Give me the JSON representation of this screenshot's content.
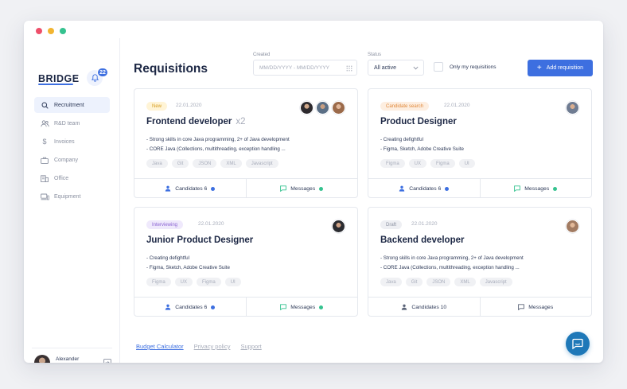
{
  "app": {
    "logo": "BRIDGE",
    "notifications_count": "22"
  },
  "sidebar": {
    "items": [
      {
        "label": "Recruitment",
        "icon": "search-icon",
        "active": true
      },
      {
        "label": "R&D team",
        "icon": "users-icon",
        "active": false
      },
      {
        "label": "Invoices",
        "icon": "dollar-icon",
        "active": false
      },
      {
        "label": "Company",
        "icon": "briefcase-icon",
        "active": false
      },
      {
        "label": "Office",
        "icon": "building-icon",
        "active": false
      },
      {
        "label": "Equipment",
        "icon": "devices-icon",
        "active": false
      }
    ],
    "user": {
      "name": "Alexander Morrison"
    }
  },
  "header": {
    "title": "Requisitions",
    "created_label": "Created",
    "date_placeholder": "MM/DD/YYYY - MM/DD/YYYY",
    "status_label": "Status",
    "status_value": "All active",
    "only_mine_label": "Only my requisitions",
    "add_button": "Add requisition"
  },
  "cards": [
    {
      "status": "New",
      "date": "22.01.2020",
      "title": "Frontend developer",
      "multiplier": "x2",
      "desc": [
        "- Strong skills in core Java programming, 2+ of Java development",
        "- CORE Java (Collections, multithreading, exception handling ..."
      ],
      "tags": [
        "Java",
        "Git",
        "JSON",
        "XML",
        "Javascript"
      ],
      "candidates_label": "Candidates",
      "candidates_count": "6",
      "messages_label": "Messages"
    },
    {
      "status": "Candidate search",
      "date": "22.01.2020",
      "title": "Product Designer",
      "desc": [
        "- Creating defightful",
        "- Figma, Sketch, Adobe Creative Suite"
      ],
      "tags": [
        "Figma",
        "UX",
        "Figma",
        "UI"
      ],
      "candidates_label": "Candidates",
      "candidates_count": "6",
      "messages_label": "Messages"
    },
    {
      "status": "Interviewing",
      "date": "22.01.2020",
      "title": "Junior Product Designer",
      "desc": [
        "- Creating defightful",
        "- Figma, Sketch, Adobe Creative Suite"
      ],
      "tags": [
        "Figma",
        "UX",
        "Figma",
        "UI"
      ],
      "candidates_label": "Candidates",
      "candidates_count": "6",
      "messages_label": "Messages"
    },
    {
      "status": "Draft",
      "date": "22.01.2020",
      "title": "Backend developer",
      "desc": [
        "- Strong skills in core Java programming, 2+ of Java development",
        "- CORE Java (Collections, multithreading, exception handling ..."
      ],
      "tags": [
        "Java",
        "Git",
        "JSON",
        "XML",
        "Javascript"
      ],
      "candidates_label": "Candidates",
      "candidates_count": "10",
      "messages_label": "Messages"
    }
  ],
  "footer": {
    "links": [
      "Budget Calculator",
      "Privacy policy",
      "Support"
    ]
  },
  "colors": {
    "accent": "#3d6fe0",
    "chat": "#1e78b8",
    "online": "#35c28f"
  }
}
